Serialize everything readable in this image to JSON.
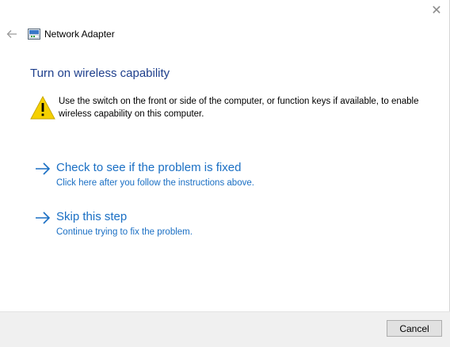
{
  "window": {
    "close_glyph": "✕"
  },
  "nav": {
    "app_title": "Network Adapter"
  },
  "content": {
    "heading": "Turn on wireless capability",
    "warning_text": "Use the switch on the front or side of the computer, or function keys if available, to enable wireless capability on this computer.",
    "options": [
      {
        "title": "Check to see if the problem is fixed",
        "subtitle": "Click here after you follow the instructions above."
      },
      {
        "title": "Skip this step",
        "subtitle": "Continue trying to fix the problem."
      }
    ]
  },
  "footer": {
    "cancel_label": "Cancel"
  },
  "colors": {
    "heading": "#1e3f8c",
    "link": "#1a6fc4",
    "warning_fill": "#f5d000"
  },
  "icons": {
    "back": "back-arrow-icon",
    "app": "network-adapter-icon",
    "warning": "warning-icon",
    "option_arrow": "right-arrow-icon",
    "close": "close-icon"
  }
}
